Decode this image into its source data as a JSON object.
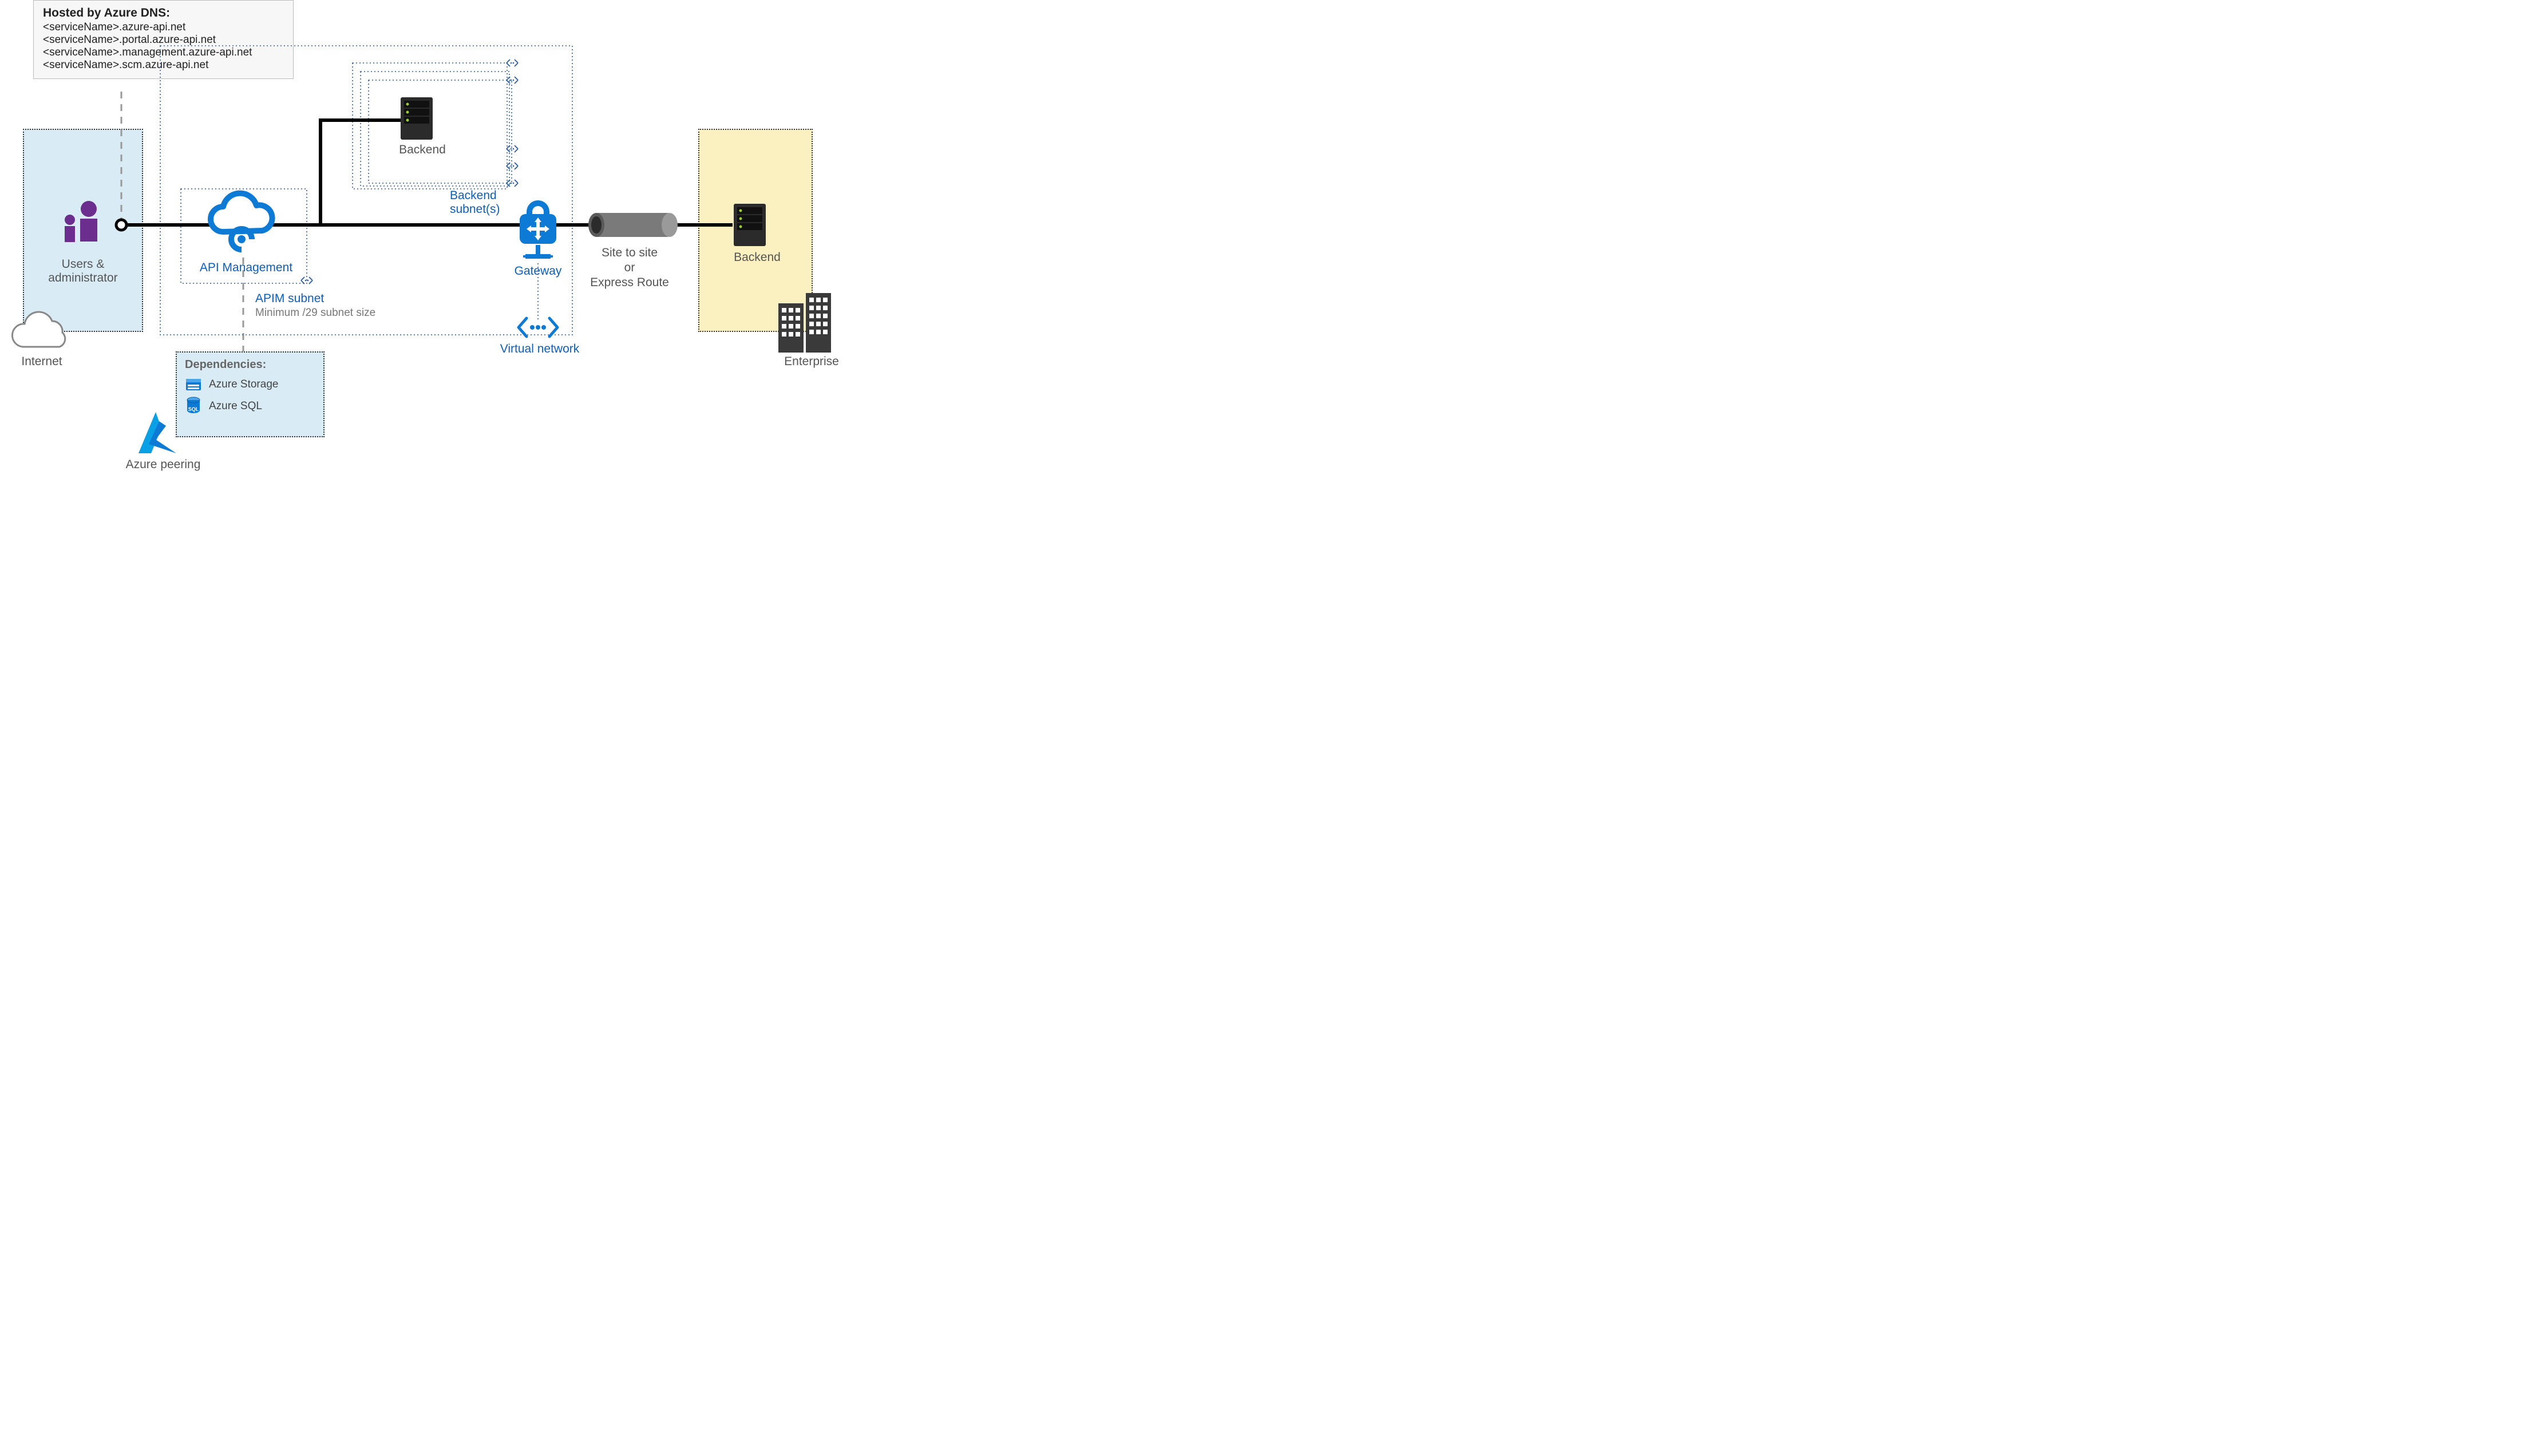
{
  "dns_box": {
    "title": "Hosted by Azure DNS:",
    "lines": [
      "<serviceName>.azure-api.net",
      "<serviceName>.portal.azure-api.net",
      "<serviceName>.management.azure-api.net",
      "<serviceName>.scm.azure-api.net"
    ]
  },
  "labels": {
    "users": "Users & administrator",
    "internet": "Internet",
    "apim": "API Management",
    "apim_subnet": "APIM subnet",
    "apim_subnet_note": "Minimum /29 subnet size",
    "backend_top": "Backend",
    "backend_subnets": "Backend subnet(s)",
    "gateway": "Gateway",
    "vn": "Virtual network",
    "tunnel_line1": "Site to site",
    "tunnel_line2": "or",
    "tunnel_line3": "Express Route",
    "backend_right": "Backend",
    "enterprise": "Enterprise",
    "azure_peering": "Azure peering"
  },
  "dependencies": {
    "title": "Dependencies:",
    "items": [
      {
        "icon": "storage-icon",
        "name": "Azure Storage"
      },
      {
        "icon": "sql-icon",
        "name": "Azure SQL"
      }
    ]
  },
  "colors": {
    "azure_blue": "#0b5fbf",
    "accent_blue": "#0d7bd6",
    "purple": "#6b2e8f",
    "gray": "#6f6f6f"
  }
}
